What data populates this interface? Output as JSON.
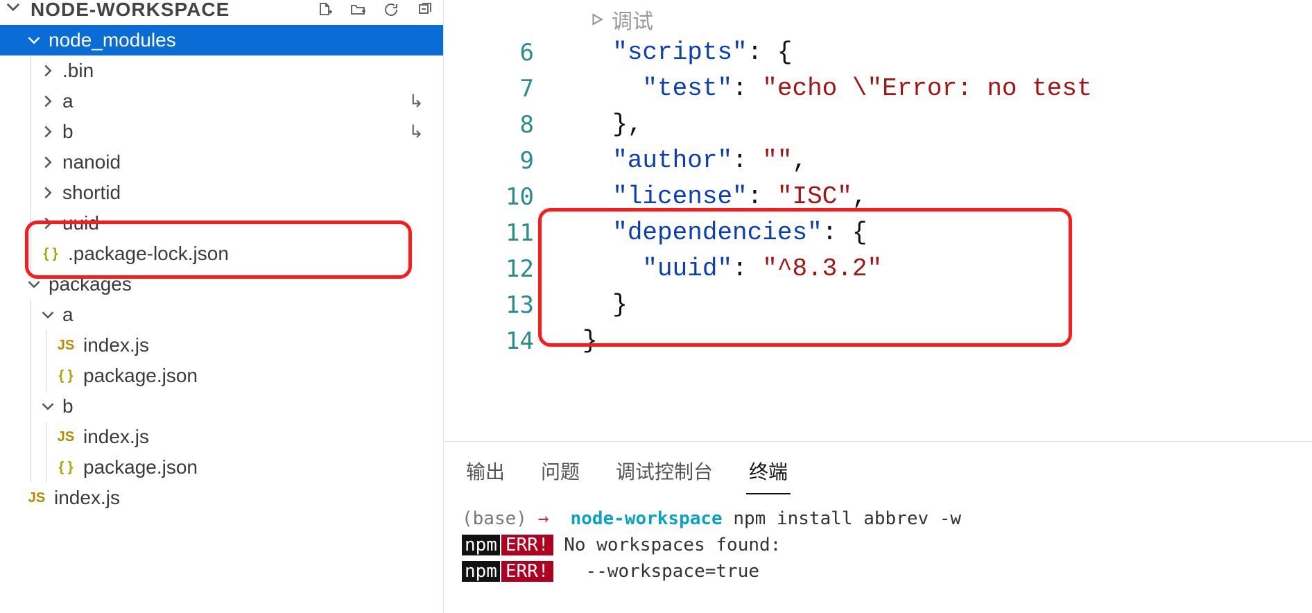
{
  "sidebar": {
    "title": "NODE-WORKSPACE",
    "actions": {
      "new_file": "new-file",
      "new_folder": "new-folder",
      "refresh": "refresh",
      "collapse": "collapse"
    },
    "tree": [
      {
        "id": "node_modules",
        "label": "node_modules",
        "kind": "folder",
        "open": true,
        "depth": 0,
        "selected": true
      },
      {
        "id": "bin",
        "label": ".bin",
        "kind": "folder",
        "open": false,
        "depth": 1
      },
      {
        "id": "a_mod",
        "label": "a",
        "kind": "folder",
        "open": false,
        "depth": 1,
        "symlink": true
      },
      {
        "id": "b_mod",
        "label": "b",
        "kind": "folder",
        "open": false,
        "depth": 1,
        "symlink": true
      },
      {
        "id": "nanoid",
        "label": "nanoid",
        "kind": "folder",
        "open": false,
        "depth": 1
      },
      {
        "id": "shortid",
        "label": "shortid",
        "kind": "folder",
        "open": false,
        "depth": 1
      },
      {
        "id": "uuid",
        "label": "uuid",
        "kind": "folder",
        "open": false,
        "depth": 1
      },
      {
        "id": "pkglock",
        "label": ".package-lock.json",
        "kind": "json",
        "depth": 1
      },
      {
        "id": "packages",
        "label": "packages",
        "kind": "folder",
        "open": true,
        "depth": 0
      },
      {
        "id": "pka",
        "label": "a",
        "kind": "folder",
        "open": true,
        "depth": 1
      },
      {
        "id": "pka_index",
        "label": "index.js",
        "kind": "js",
        "depth": 2
      },
      {
        "id": "pka_pkg",
        "label": "package.json",
        "kind": "json",
        "depth": 2
      },
      {
        "id": "pkb",
        "label": "b",
        "kind": "folder",
        "open": true,
        "depth": 1
      },
      {
        "id": "pkb_index",
        "label": "index.js",
        "kind": "js",
        "depth": 2
      },
      {
        "id": "pkb_pkg",
        "label": "package.json",
        "kind": "json",
        "depth": 2
      },
      {
        "id": "root_index",
        "label": "index.js",
        "kind": "js",
        "depth": 0
      }
    ]
  },
  "editor": {
    "debug_label": "调试",
    "lines": [
      {
        "n": 6,
        "indent": 1,
        "tokens": [
          {
            "t": "\"scripts\"",
            "c": "key"
          },
          {
            "t": ": {",
            "c": "punc"
          }
        ]
      },
      {
        "n": 7,
        "indent": 2,
        "tokens": [
          {
            "t": "\"test\"",
            "c": "key"
          },
          {
            "t": ": ",
            "c": "punc"
          },
          {
            "t": "\"echo \\\"Error: no test ",
            "c": "str"
          }
        ]
      },
      {
        "n": 8,
        "indent": 1,
        "tokens": [
          {
            "t": "},",
            "c": "punc"
          }
        ]
      },
      {
        "n": 9,
        "indent": 1,
        "tokens": [
          {
            "t": "\"author\"",
            "c": "key"
          },
          {
            "t": ": ",
            "c": "punc"
          },
          {
            "t": "\"\"",
            "c": "str"
          },
          {
            "t": ",",
            "c": "punc"
          }
        ]
      },
      {
        "n": 10,
        "indent": 1,
        "tokens": [
          {
            "t": "\"license\"",
            "c": "key"
          },
          {
            "t": ": ",
            "c": "punc"
          },
          {
            "t": "\"ISC\"",
            "c": "str"
          },
          {
            "t": ",",
            "c": "punc"
          }
        ]
      },
      {
        "n": 11,
        "indent": 1,
        "tokens": [
          {
            "t": "\"dependencies\"",
            "c": "key"
          },
          {
            "t": ": {",
            "c": "punc"
          }
        ]
      },
      {
        "n": 12,
        "indent": 2,
        "tokens": [
          {
            "t": "\"uuid\"",
            "c": "key"
          },
          {
            "t": ": ",
            "c": "punc"
          },
          {
            "t": "\"^8.3.2\"",
            "c": "str"
          }
        ]
      },
      {
        "n": 13,
        "indent": 1,
        "tokens": [
          {
            "t": "}",
            "c": "punc"
          }
        ]
      },
      {
        "n": 14,
        "indent": 0,
        "tokens": [
          {
            "t": "}",
            "c": "punc"
          }
        ]
      }
    ]
  },
  "panel": {
    "tabs": [
      {
        "id": "output",
        "label": "输出"
      },
      {
        "id": "problems",
        "label": "问题"
      },
      {
        "id": "debug",
        "label": "调试控制台"
      },
      {
        "id": "terminal",
        "label": "终端",
        "active": true
      }
    ],
    "terminal": {
      "prompt_env": "(base)",
      "prompt_arrow": "→",
      "prompt_path": "node-workspace",
      "command": "npm install abbrev -w",
      "err_lines": [
        "No workspaces found:",
        "  --workspace=true"
      ],
      "npm_label": "npm",
      "err_label": "ERR!"
    }
  },
  "callouts": {
    "sidebar_uuid": true,
    "editor_deps": true
  }
}
